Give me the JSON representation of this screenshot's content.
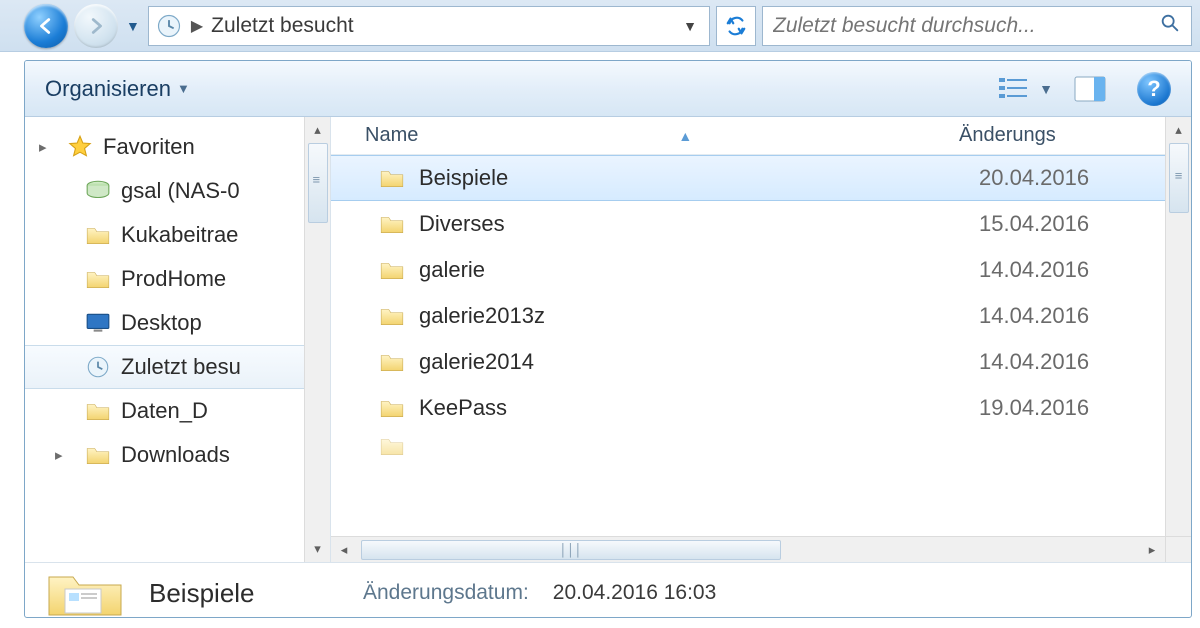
{
  "nav": {
    "location": "Zuletzt besucht",
    "search_placeholder": "Zuletzt besucht durchsuch..."
  },
  "toolbar": {
    "organize_label": "Organisieren"
  },
  "sidebar": {
    "favorites_label": "Favoriten",
    "items": [
      {
        "label": "gsal (NAS-0",
        "icon": "drive"
      },
      {
        "label": "Kukabeitrae",
        "icon": "folder"
      },
      {
        "label": "ProdHome",
        "icon": "folder"
      },
      {
        "label": "Desktop",
        "icon": "desktop"
      },
      {
        "label": "Zuletzt besu",
        "icon": "recent",
        "selected": true
      },
      {
        "label": "Daten_D",
        "icon": "folder"
      },
      {
        "label": "Downloads",
        "icon": "folder"
      }
    ]
  },
  "columns": {
    "name": "Name",
    "date": "Änderungs"
  },
  "files": [
    {
      "name": "Beispiele",
      "date": "20.04.2016",
      "selected": true
    },
    {
      "name": "Diverses",
      "date": "15.04.2016"
    },
    {
      "name": "galerie",
      "date": "14.04.2016"
    },
    {
      "name": "galerie2013z",
      "date": "14.04.2016"
    },
    {
      "name": "galerie2014",
      "date": "14.04.2016"
    },
    {
      "name": "KeePass",
      "date": "19.04.2016"
    }
  ],
  "details": {
    "title": "Beispiele",
    "date_label": "Änderungsdatum:",
    "date_value": "20.04.2016 16:03"
  }
}
